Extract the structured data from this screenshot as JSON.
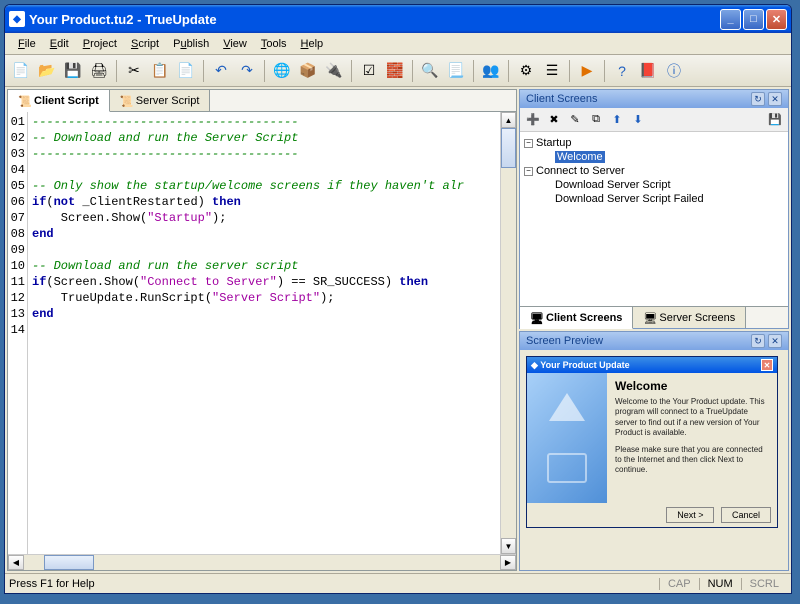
{
  "window": {
    "title": "Your Product.tu2 - TrueUpdate"
  },
  "menu": {
    "file": "File",
    "edit": "Edit",
    "project": "Project",
    "script": "Script",
    "publish": "Publish",
    "view": "View",
    "tools": "Tools",
    "help": "Help"
  },
  "tabs": {
    "client": "Client Script",
    "server": "Server Script"
  },
  "code": {
    "lines": [
      {
        "n": "01",
        "type": "com",
        "text": "-------------------------------------"
      },
      {
        "n": "02",
        "type": "com",
        "text": "-- Download and run the Server Script"
      },
      {
        "n": "03",
        "type": "com",
        "text": "-------------------------------------"
      },
      {
        "n": "04",
        "type": "plain",
        "text": ""
      },
      {
        "n": "05",
        "type": "com",
        "text": "-- Only show the startup/welcome screens if they haven't alr"
      },
      {
        "n": "06",
        "type": "code1"
      },
      {
        "n": "07",
        "type": "code2"
      },
      {
        "n": "08",
        "type": "end"
      },
      {
        "n": "09",
        "type": "plain",
        "text": ""
      },
      {
        "n": "10",
        "type": "com",
        "text": "-- Download and run the server script"
      },
      {
        "n": "11",
        "type": "code3"
      },
      {
        "n": "12",
        "type": "code4"
      },
      {
        "n": "13",
        "type": "end"
      },
      {
        "n": "14",
        "type": "plain",
        "text": ""
      }
    ],
    "kw_if": "if",
    "kw_not": "not",
    "kw_then": "then",
    "kw_end": "end",
    "var1": " _ClientRestarted) ",
    "l7a": "    Screen.Show(",
    "str_startup": "\"Startup\"",
    "l7b": ");",
    "l11a": "(Screen.Show(",
    "str_connect": "\"Connect to Server\"",
    "l11b": ") == SR_SUCCESS) ",
    "l12a": "    TrueUpdate.RunScript(",
    "str_server": "\"Server Script\"",
    "l12b": ");"
  },
  "right_panel": {
    "title": "Client Screens",
    "tree": {
      "startup": "Startup",
      "welcome": "Welcome",
      "connect": "Connect to Server",
      "dl_script": "Download Server Script",
      "dl_failed": "Download Server Script Failed"
    },
    "tabs": {
      "client": "Client Screens",
      "server": "Server Screens"
    }
  },
  "preview": {
    "title": "Screen Preview",
    "dialog_title": "Your Product Update",
    "heading": "Welcome",
    "para1": "Welcome to the Your Product update. This program will connect to a TrueUpdate server to find out if a new version of Your Product is available.",
    "para2": "Please make sure that you are connected to the Internet and then click Next to continue.",
    "btn_next": "Next >",
    "btn_cancel": "Cancel"
  },
  "status": {
    "help": "Press F1 for Help",
    "cap": "CAP",
    "num": "NUM",
    "scrl": "SCRL"
  }
}
